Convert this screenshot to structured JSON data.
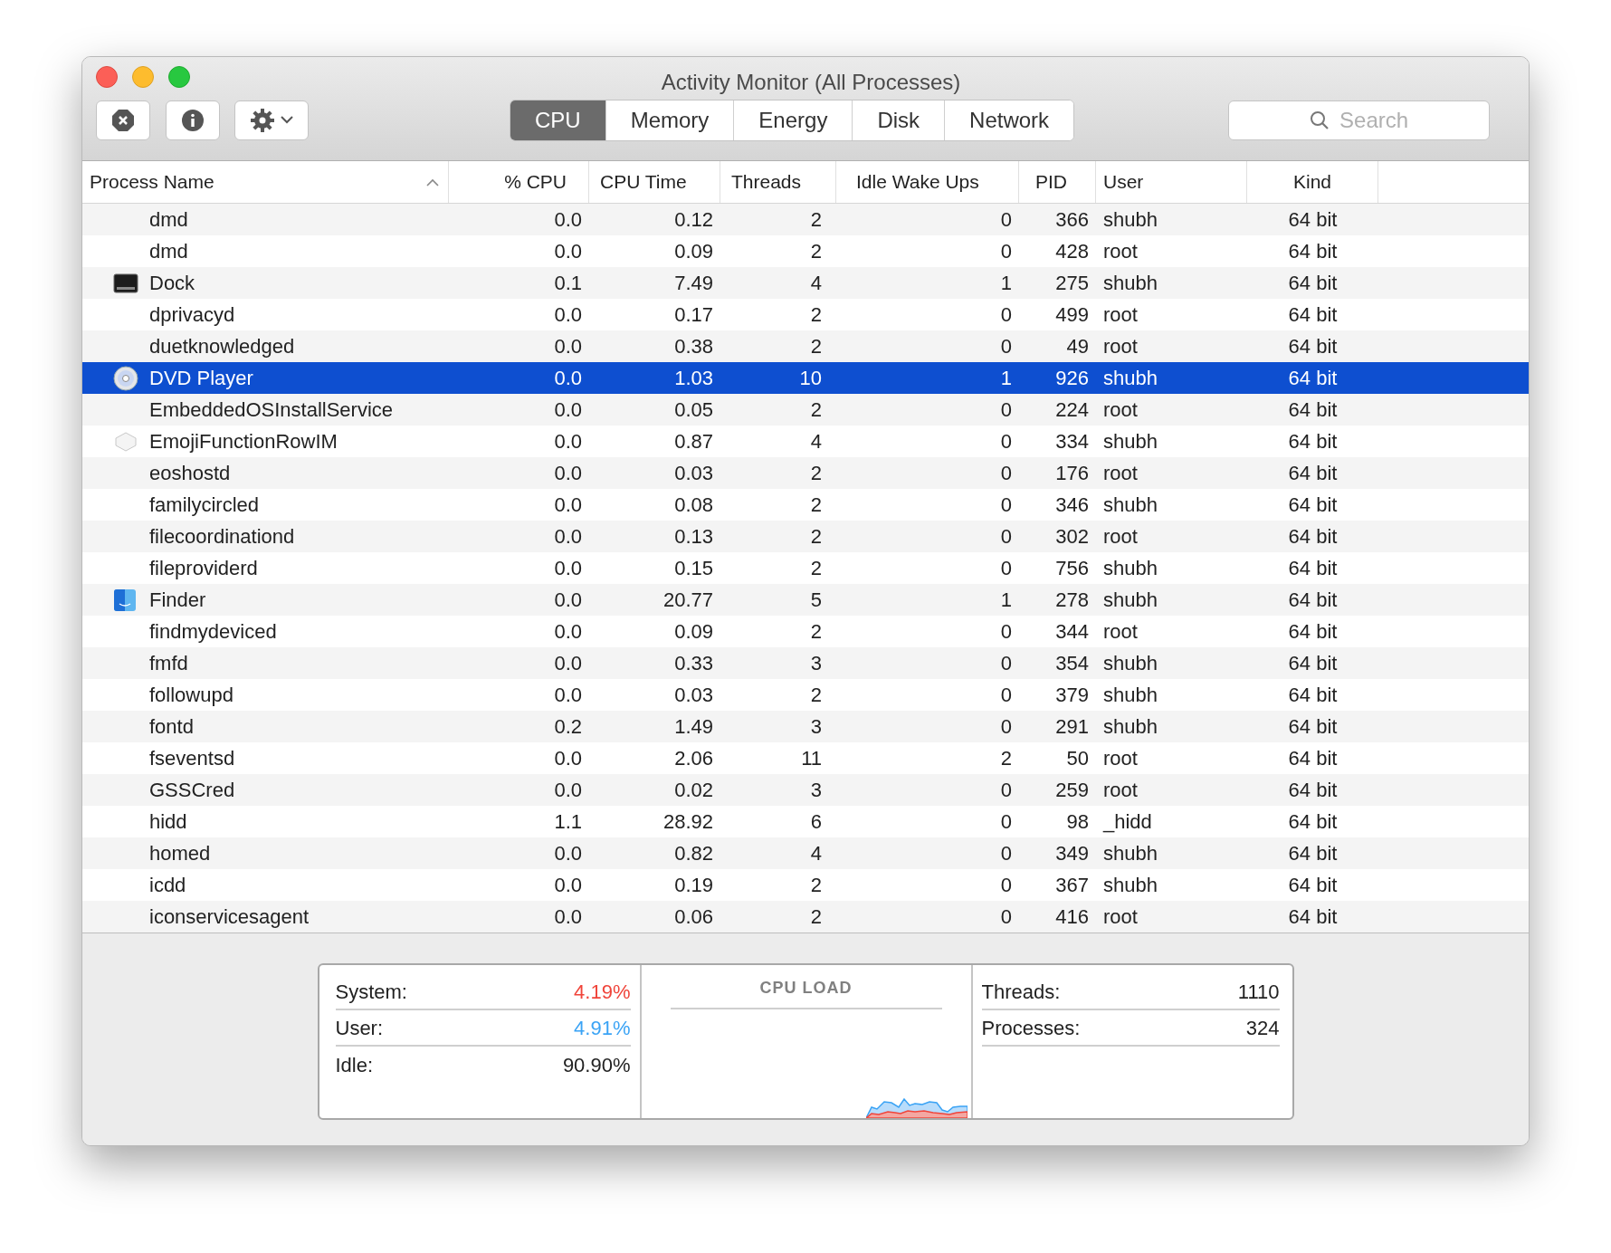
{
  "window": {
    "title": "Activity Monitor (All Processes)"
  },
  "tabs": [
    {
      "label": "CPU",
      "selected": true
    },
    {
      "label": "Memory",
      "selected": false
    },
    {
      "label": "Energy",
      "selected": false
    },
    {
      "label": "Disk",
      "selected": false
    },
    {
      "label": "Network",
      "selected": false
    }
  ],
  "search": {
    "placeholder": "Search"
  },
  "table": {
    "columns": [
      {
        "label": "Process Name",
        "sorted": true
      },
      {
        "label": "% CPU",
        "sorted": false
      },
      {
        "label": "CPU Time",
        "sorted": false
      },
      {
        "label": "Threads",
        "sorted": false
      },
      {
        "label": "Idle Wake Ups",
        "sorted": false
      },
      {
        "label": "PID",
        "sorted": false
      },
      {
        "label": "User",
        "sorted": false
      },
      {
        "label": "Kind",
        "sorted": false
      }
    ],
    "rows": [
      {
        "kind": "plain",
        "selected": false,
        "cells": [
          "dmd",
          "0.0",
          "0.12",
          "2",
          "0",
          "366",
          "shubh",
          "64 bit"
        ]
      },
      {
        "kind": "plain",
        "selected": false,
        "cells": [
          "dmd",
          "0.0",
          "0.09",
          "2",
          "0",
          "428",
          "root",
          "64 bit"
        ]
      },
      {
        "kind": "dock",
        "selected": false,
        "cells": [
          "Dock",
          "0.1",
          "7.49",
          "4",
          "1",
          "275",
          "shubh",
          "64 bit"
        ]
      },
      {
        "kind": "plain",
        "selected": false,
        "cells": [
          "dprivacyd",
          "0.0",
          "0.17",
          "2",
          "0",
          "499",
          "root",
          "64 bit"
        ]
      },
      {
        "kind": "plain",
        "selected": false,
        "cells": [
          "duetknowledged",
          "0.0",
          "0.38",
          "2",
          "0",
          "49",
          "root",
          "64 bit"
        ]
      },
      {
        "kind": "disc",
        "selected": true,
        "cells": [
          "DVD Player",
          "0.0",
          "1.03",
          "10",
          "1",
          "926",
          "shubh",
          "64 bit"
        ]
      },
      {
        "kind": "plain",
        "selected": false,
        "cells": [
          "EmbeddedOSInstallService",
          "0.0",
          "0.05",
          "2",
          "0",
          "224",
          "root",
          "64 bit"
        ]
      },
      {
        "kind": "emoji",
        "selected": false,
        "cells": [
          "EmojiFunctionRowIM",
          "0.0",
          "0.87",
          "4",
          "0",
          "334",
          "shubh",
          "64 bit"
        ]
      },
      {
        "kind": "plain",
        "selected": false,
        "cells": [
          "eoshostd",
          "0.0",
          "0.03",
          "2",
          "0",
          "176",
          "root",
          "64 bit"
        ]
      },
      {
        "kind": "plain",
        "selected": false,
        "cells": [
          "familycircled",
          "0.0",
          "0.08",
          "2",
          "0",
          "346",
          "shubh",
          "64 bit"
        ]
      },
      {
        "kind": "plain",
        "selected": false,
        "cells": [
          "filecoordinationd",
          "0.0",
          "0.13",
          "2",
          "0",
          "302",
          "root",
          "64 bit"
        ]
      },
      {
        "kind": "plain",
        "selected": false,
        "cells": [
          "fileproviderd",
          "0.0",
          "0.15",
          "2",
          "0",
          "756",
          "shubh",
          "64 bit"
        ]
      },
      {
        "kind": "finder",
        "selected": false,
        "cells": [
          "Finder",
          "0.0",
          "20.77",
          "5",
          "1",
          "278",
          "shubh",
          "64 bit"
        ]
      },
      {
        "kind": "plain",
        "selected": false,
        "cells": [
          "findmydeviced",
          "0.0",
          "0.09",
          "2",
          "0",
          "344",
          "root",
          "64 bit"
        ]
      },
      {
        "kind": "plain",
        "selected": false,
        "cells": [
          "fmfd",
          "0.0",
          "0.33",
          "3",
          "0",
          "354",
          "shubh",
          "64 bit"
        ]
      },
      {
        "kind": "plain",
        "selected": false,
        "cells": [
          "followupd",
          "0.0",
          "0.03",
          "2",
          "0",
          "379",
          "shubh",
          "64 bit"
        ]
      },
      {
        "kind": "plain",
        "selected": false,
        "cells": [
          "fontd",
          "0.2",
          "1.49",
          "3",
          "0",
          "291",
          "shubh",
          "64 bit"
        ]
      },
      {
        "kind": "plain",
        "selected": false,
        "cells": [
          "fseventsd",
          "0.0",
          "2.06",
          "11",
          "2",
          "50",
          "root",
          "64 bit"
        ]
      },
      {
        "kind": "plain",
        "selected": false,
        "cells": [
          "GSSCred",
          "0.0",
          "0.02",
          "3",
          "0",
          "259",
          "root",
          "64 bit"
        ]
      },
      {
        "kind": "plain",
        "selected": false,
        "cells": [
          "hidd",
          "1.1",
          "28.92",
          "6",
          "0",
          "98",
          "_hidd",
          "64 bit"
        ]
      },
      {
        "kind": "plain",
        "selected": false,
        "cells": [
          "homed",
          "0.0",
          "0.82",
          "4",
          "0",
          "349",
          "shubh",
          "64 bit"
        ]
      },
      {
        "kind": "plain",
        "selected": false,
        "cells": [
          "icdd",
          "0.0",
          "0.19",
          "2",
          "0",
          "367",
          "shubh",
          "64 bit"
        ]
      },
      {
        "kind": "plain",
        "selected": false,
        "cells": [
          "iconservicesagent",
          "0.0",
          "0.06",
          "2",
          "0",
          "416",
          "root",
          "64 bit"
        ]
      }
    ]
  },
  "summary": {
    "left": [
      {
        "label": "System:",
        "value": "4.19%",
        "color": "#f0443a"
      },
      {
        "label": "User:",
        "value": "4.91%",
        "color": "#3aa3f5"
      },
      {
        "label": "Idle:",
        "value": "90.90%",
        "color": "#222222"
      }
    ],
    "chart_title": "CPU LOAD",
    "right": [
      {
        "label": "Threads:",
        "value": "1110"
      },
      {
        "label": "Processes:",
        "value": "324"
      }
    ]
  }
}
